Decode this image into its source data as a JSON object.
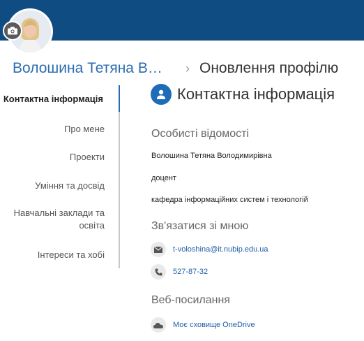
{
  "header": {
    "name": "Волошина Тетяна Володимирівна",
    "separator": "›",
    "page_title": "Оновлення профілю"
  },
  "nav": {
    "items": [
      {
        "label": "Контактна інформація",
        "active": true
      },
      {
        "label": "Про мене"
      },
      {
        "label": "Проекти"
      },
      {
        "label": "Уміння та досвід"
      },
      {
        "label": "Навчальні заклади та освіта"
      },
      {
        "label": "Інтереси та хобі"
      }
    ]
  },
  "content": {
    "title": "Контактна інформація",
    "personal": {
      "heading": "Особисті відомості",
      "full_name": "Волошина Тетяна Володимирівна",
      "position": "доцент",
      "department": "кафедра інформаційних систем і технологій"
    },
    "contact": {
      "heading": "Зв'язатися зі мною",
      "email": "t-voloshina@it.nubip.edu.ua",
      "phone": "527-87-32"
    },
    "web": {
      "heading": "Веб-посилання",
      "onedrive": "Моє сховище OneDrive"
    }
  },
  "colors": {
    "topbar": "#0f4c81",
    "accent": "#2b6cb0",
    "icon_blue": "#1e6bb8"
  },
  "icons": [
    "camera-icon",
    "person-icon",
    "mail-icon",
    "phone-icon",
    "cloud-icon"
  ]
}
